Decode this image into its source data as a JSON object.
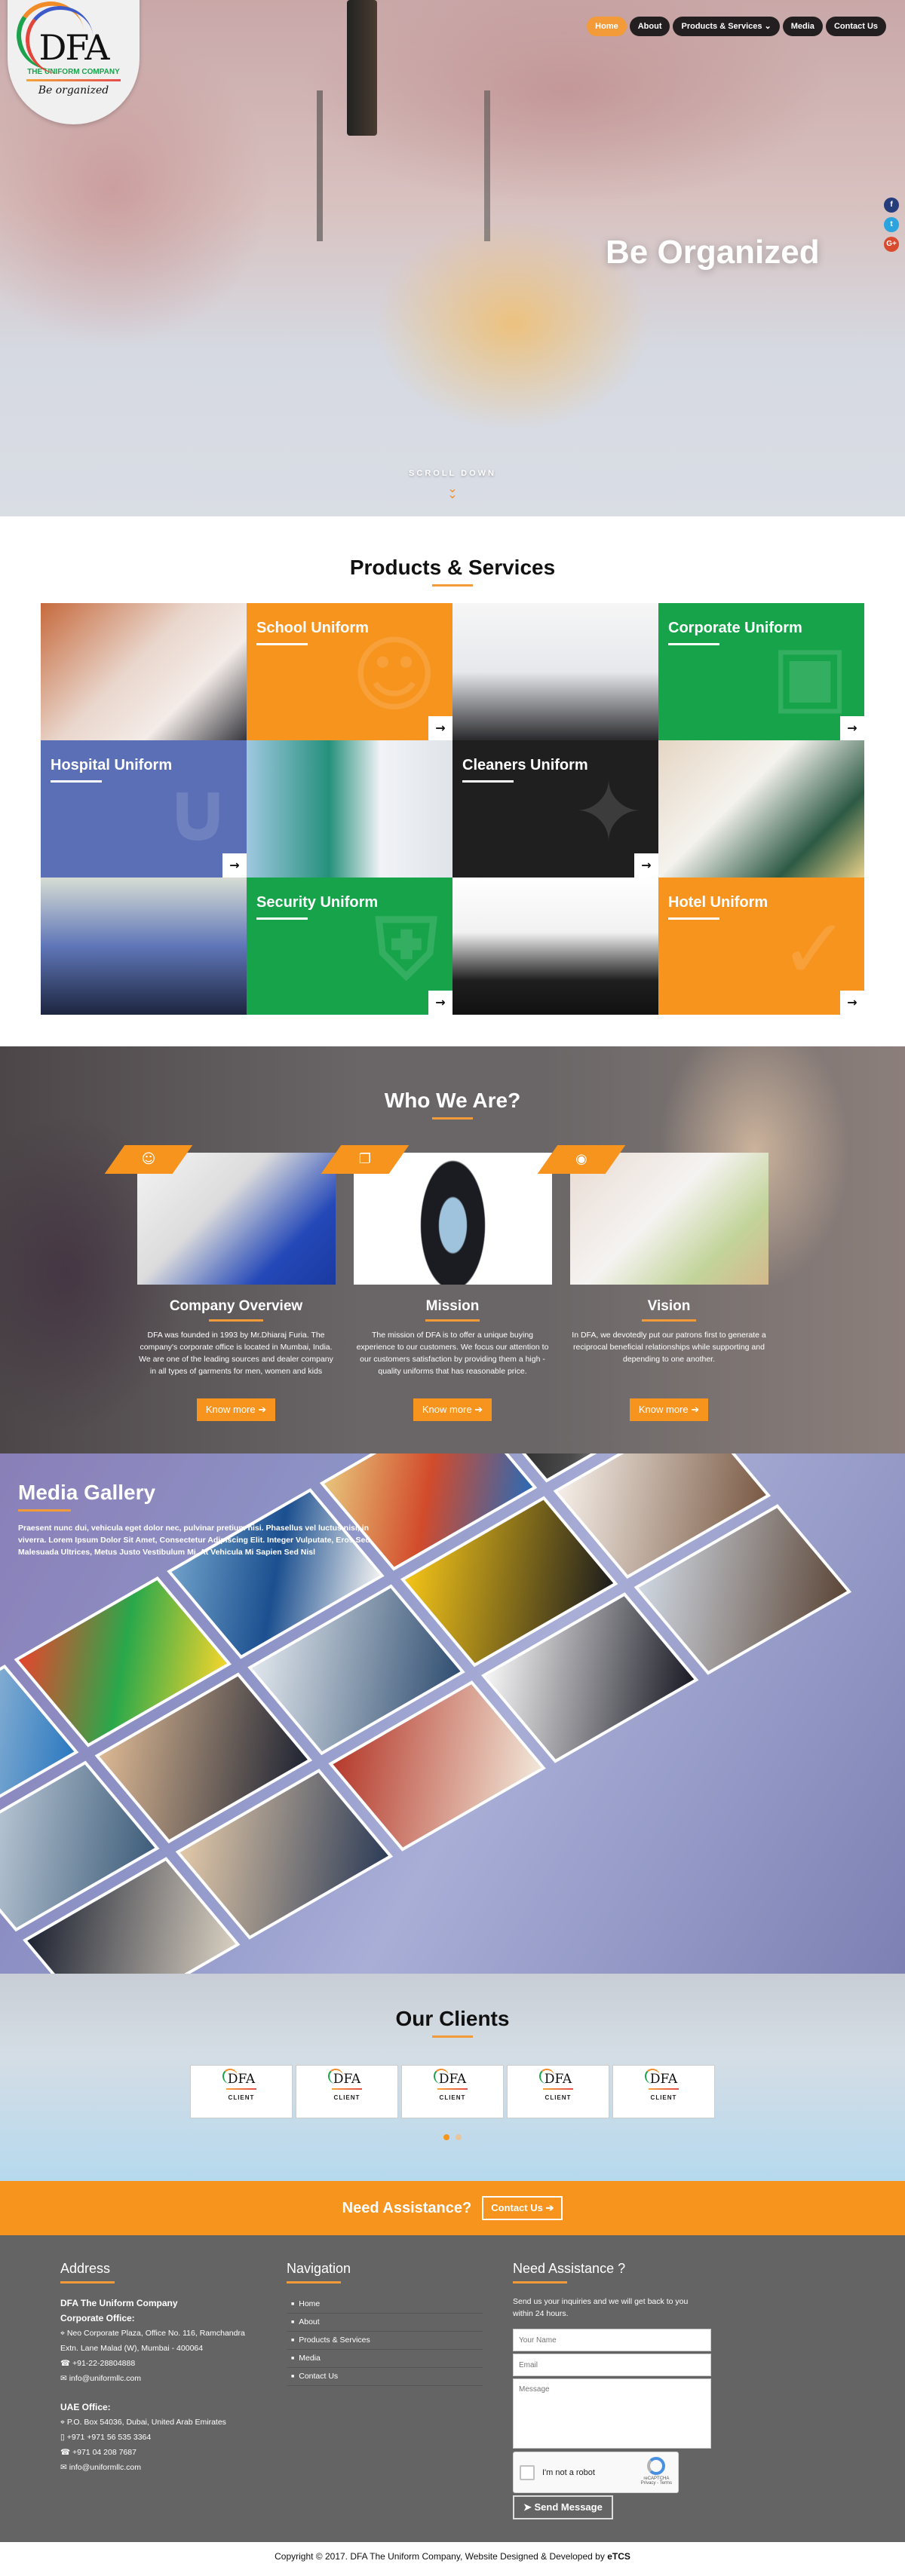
{
  "brand": {
    "logo_mark": "DFA",
    "logo_subtitle": "THE UNIFORM COMPANY",
    "logo_tagline": "Be organized"
  },
  "nav": {
    "items": [
      {
        "label": "Home",
        "active": true
      },
      {
        "label": "About"
      },
      {
        "label": "Products & Services ⌄"
      },
      {
        "label": "Media"
      },
      {
        "label": "Contact Us"
      }
    ]
  },
  "social": {
    "facebook": "f",
    "twitter": "t",
    "google_plus": "G+"
  },
  "hero": {
    "title": "Be Organized",
    "scroll_label": "SCROLL DOWN",
    "scroll_icon": "»"
  },
  "products": {
    "title": "Products & Services",
    "tiles": [
      {
        "label": "School Uniform",
        "color": "#f7941e"
      },
      {
        "label": "Corporate Uniform",
        "color": "#16a34a"
      },
      {
        "label": "Hospital Uniform",
        "color": "#5b6fb7"
      },
      {
        "label": "Cleaners Uniform",
        "color": "#1f1f1f"
      },
      {
        "label": "Security Uniform",
        "color": "#16a34a"
      },
      {
        "label": "Hotel Uniform",
        "color": "#f7941e"
      }
    ],
    "arrow": "→"
  },
  "who": {
    "title": "Who We Are?",
    "cards": [
      {
        "icon": "☺",
        "title": "Company Overview",
        "text": "DFA was founded in 1993 by Mr.Dhiaraj Furia. The company's corporate office is located in Mumbai, India. We are one of the leading sources and dealer company in all types of garments for men, women and kids",
        "button": "Know more ➔"
      },
      {
        "icon": "❐",
        "title": "Mission",
        "text": "The mission of DFA is to offer a unique buying experience to our customers. We focus our attention to our customers satisfaction by providing them a high - quality uniforms that has reasonable price.",
        "button": "Know more ➔"
      },
      {
        "icon": "◉",
        "title": "Vision",
        "text": "In DFA, we devotedly put our patrons first to generate a reciprocal beneficial relationships while supporting and depending to one another.",
        "button": "Know more ➔"
      }
    ]
  },
  "media": {
    "title": "Media Gallery",
    "text": "Praesent nunc dui, vehicula eget dolor nec, pulvinar pretium nisi. Phasellus vel luctus nisi, in viverra. Lorem Ipsum Dolor Sit Amet, Consectetur Adipiscing Elit. Integer Vulputate, Eros Sed Malesuada Ultrices, Metus Justo Vestibulum Mi, At Vehicula Mi Sapien Sed Nisl"
  },
  "clients": {
    "title": "Our Clients",
    "items": [
      {
        "mark": "DFA",
        "label": "CLIENT"
      },
      {
        "mark": "DFA",
        "label": "CLIENT"
      },
      {
        "mark": "DFA",
        "label": "CLIENT"
      },
      {
        "mark": "DFA",
        "label": "CLIENT"
      },
      {
        "mark": "DFA",
        "label": "CLIENT"
      }
    ],
    "carousel": {
      "pages": 2,
      "active": 1
    }
  },
  "cta": {
    "title": "Need Assistance?",
    "button": "Contact Us ➔"
  },
  "footer": {
    "address": {
      "title": "Address",
      "company": "DFA The Uniform Company",
      "corporate_label": "Corporate Office:",
      "corporate_address": "⌖ Neo Corporate Plaza, Office No. 116, Ramchandra Extn. Lane Malad (W), Mumbai - 400064",
      "corporate_phone": "☎ +91-22-28804888",
      "corporate_email": "✉ info@uniformllc.com",
      "uae_label": "UAE Office:",
      "uae_address": "⌖ P.O. Box 54036, Dubai, United Arab Emirates",
      "uae_mobile": "▯ +971 +971 56 535 3364",
      "uae_phone": "☎ +971 04 208 7687",
      "uae_email": "✉ info@uniformllc.com"
    },
    "navigation": {
      "title": "Navigation",
      "items": [
        "Home",
        "About",
        "Products & Services",
        "Media",
        "Contact Us"
      ]
    },
    "form": {
      "title": "Need Assistance ?",
      "intro": "Send us your inquiries and we will get back to you within 24 hours.",
      "name_placeholder": "Your Name",
      "email_placeholder": "Email",
      "message_placeholder": "Message",
      "captcha_label": "I'm not a robot",
      "captcha_brand": "reCAPTCHA",
      "captcha_links": "Privacy - Terms",
      "send_button": "➤ Send Message"
    }
  },
  "copyright": {
    "text": "Copyright © 2017. DFA The Uniform Company, Website Designed & Developed by ",
    "developer": "eTCS"
  },
  "colors": {
    "accent": "#f7941e",
    "dark": "#231f20",
    "footer": "#646464"
  }
}
